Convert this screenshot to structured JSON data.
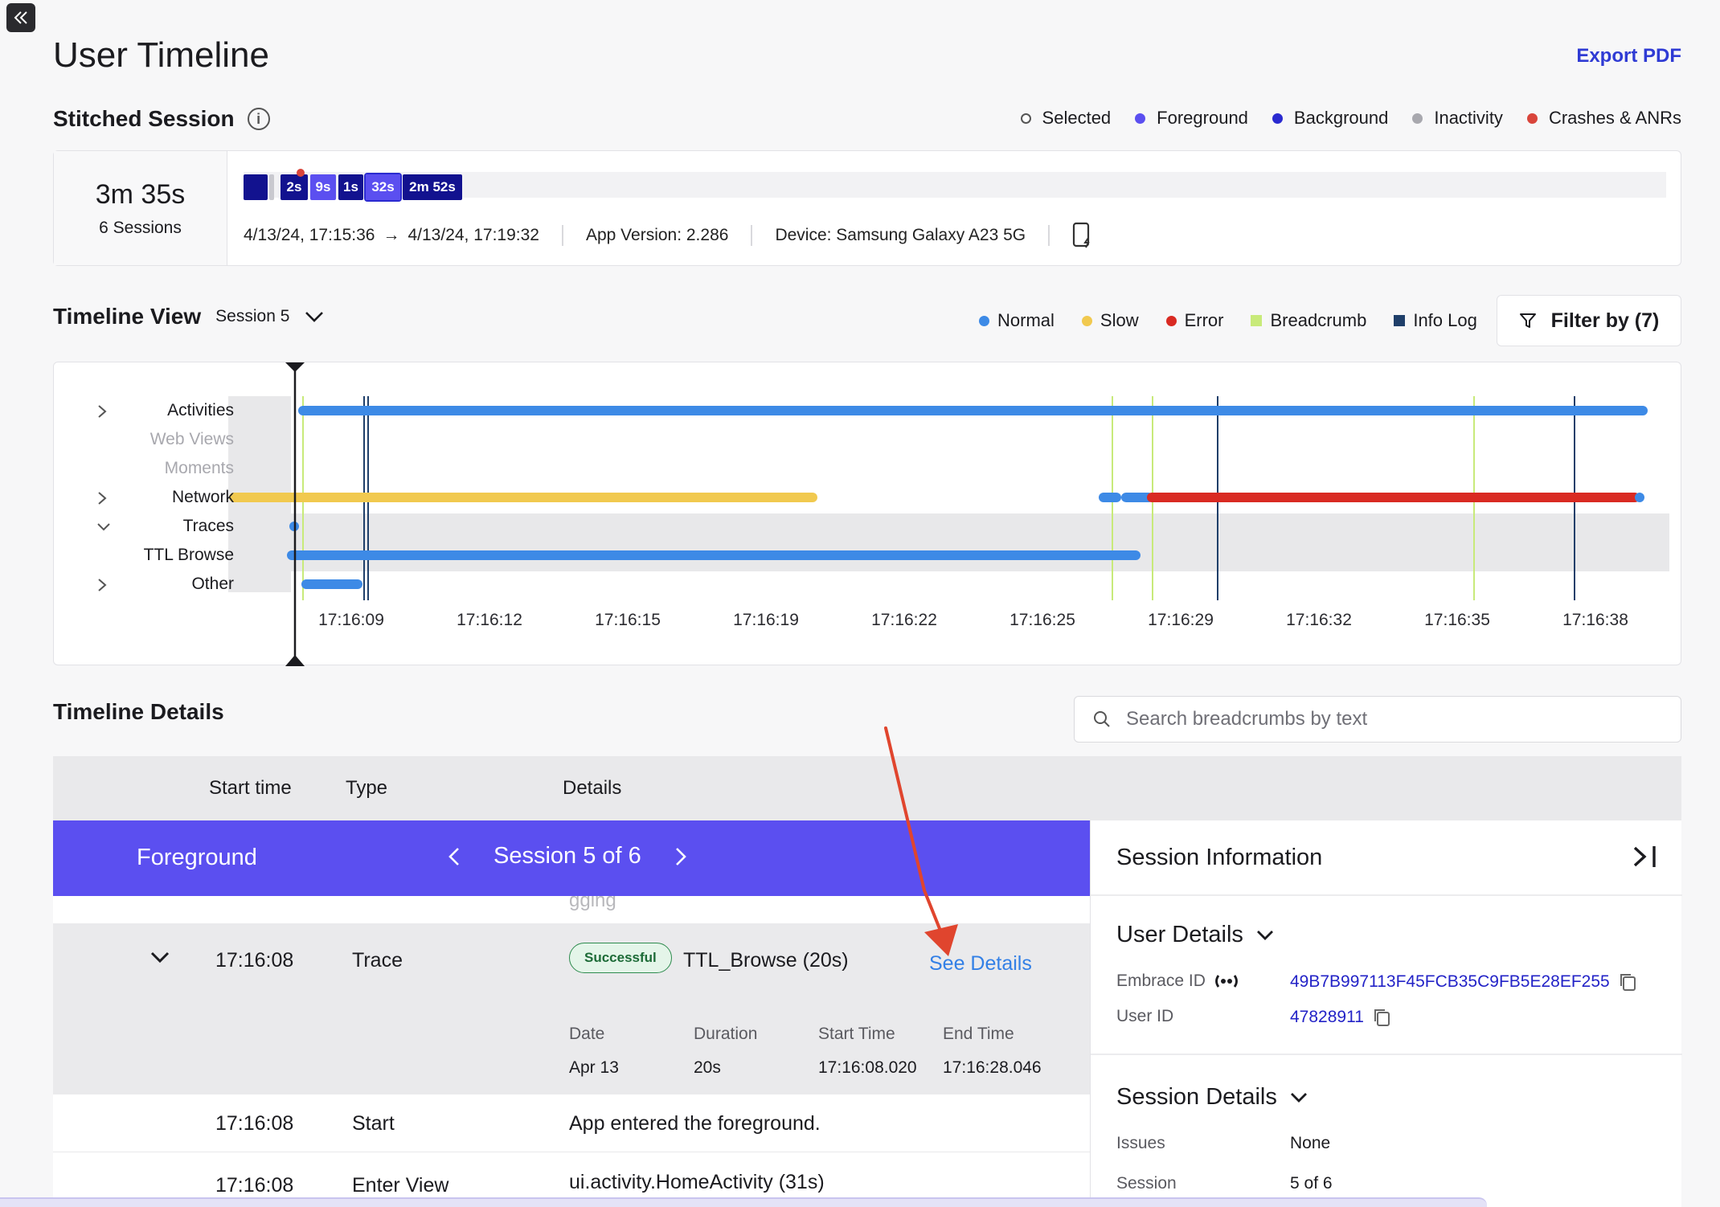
{
  "page": {
    "title": "User Timeline",
    "export_label": "Export PDF"
  },
  "stitched": {
    "title": "Stitched Session",
    "info_icon": "info-icon",
    "legend": [
      {
        "label": "Selected",
        "color": "#ffffff"
      },
      {
        "label": "Foreground",
        "color": "#5b4ff0"
      },
      {
        "label": "Background",
        "color": "#2a2ad0"
      },
      {
        "label": "Inactivity",
        "color": "#a8a8ae"
      },
      {
        "label": "Crashes & ANRs",
        "color": "#d9453b"
      }
    ],
    "total_duration": "3m 35s",
    "session_count": "6 Sessions",
    "segments": [
      "",
      "2s",
      "9s",
      "1s",
      "32s",
      "2m 52s"
    ],
    "time_range_start": "4/13/24, 17:15:36",
    "time_range_arrow": "→",
    "time_range_end": "4/13/24, 17:19:32",
    "app_version": "App Version: 2.286",
    "device": "Device: Samsung Galaxy A23 5G",
    "device_icon": "phone-power-icon"
  },
  "timeline_view": {
    "title": "Timeline View",
    "session_selected": "Session 5",
    "legend": [
      {
        "label": "Normal",
        "color": "#3d8ae6",
        "shape": "dot"
      },
      {
        "label": "Slow",
        "color": "#f1c94f",
        "shape": "dot"
      },
      {
        "label": "Error",
        "color": "#d92a22",
        "shape": "dot"
      },
      {
        "label": "Breadcrumb",
        "color": "#c8ea7a",
        "shape": "square"
      },
      {
        "label": "Info Log",
        "color": "#1f3f6a",
        "shape": "square"
      }
    ],
    "filter_label": "Filter by (7)",
    "rows": [
      {
        "label": "Activities",
        "expandable": true,
        "dim": false
      },
      {
        "label": "Web Views",
        "expandable": false,
        "dim": true
      },
      {
        "label": "Moments",
        "expandable": false,
        "dim": true
      },
      {
        "label": "Network",
        "expandable": true,
        "dim": false
      },
      {
        "label": "Traces",
        "expandable": true,
        "dim": false,
        "expanded": true
      },
      {
        "label": "TTL Browse",
        "expandable": false,
        "dim": false
      },
      {
        "label": "Other",
        "expandable": true,
        "dim": false
      }
    ],
    "ticks": [
      "17:16:09",
      "17:16:12",
      "17:16:15",
      "17:16:19",
      "17:16:22",
      "17:16:25",
      "17:16:29",
      "17:16:32",
      "17:16:35",
      "17:16:38"
    ]
  },
  "details": {
    "title": "Timeline Details",
    "search_placeholder": "Search breadcrumbs by text",
    "columns": {
      "start": "Start time",
      "type": "Type",
      "details": "Details"
    },
    "banner": {
      "label": "Foreground",
      "session_nav": "Session 5 of 6"
    },
    "faded_text": "gging",
    "trace": {
      "time": "17:16:08",
      "type": "Trace",
      "status": "Successful",
      "name": "TTL_Browse (20s)",
      "see_details": "See Details",
      "sub_headers": [
        "Date",
        "Duration",
        "Start Time",
        "End Time"
      ],
      "sub_values": [
        "Apr 13",
        "20s",
        "17:16:08.020",
        "17:16:28.046"
      ]
    },
    "rows": [
      {
        "time": "17:16:08",
        "type": "Start",
        "details": "App entered the foreground."
      },
      {
        "time": "17:16:08",
        "type": "Enter View",
        "details": "ui.activity.HomeActivity (31s)"
      }
    ]
  },
  "side_panel": {
    "title": "Session Information",
    "user_details": {
      "title": "User Details",
      "embrace_id_label": "Embrace ID",
      "embrace_id": "49B7B997113F45FCB35C9FB5E28EF255",
      "user_id_label": "User ID",
      "user_id": "47828911"
    },
    "session_details": {
      "title": "Session Details",
      "issues_label": "Issues",
      "issues": "None",
      "session_label": "Session",
      "session": "5 of 6"
    }
  }
}
